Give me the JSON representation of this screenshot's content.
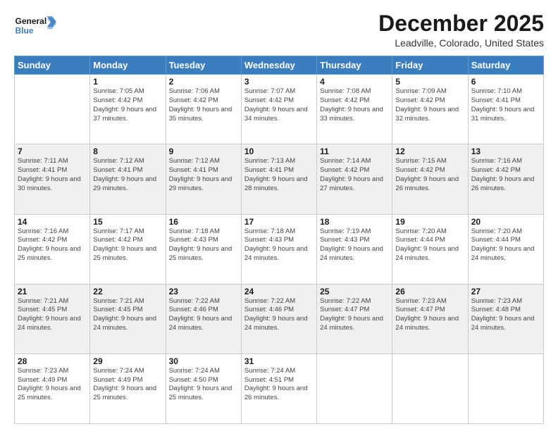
{
  "header": {
    "logo_general": "General",
    "logo_blue": "Blue",
    "month_title": "December 2025",
    "location": "Leadville, Colorado, United States"
  },
  "weekdays": [
    "Sunday",
    "Monday",
    "Tuesday",
    "Wednesday",
    "Thursday",
    "Friday",
    "Saturday"
  ],
  "weeks": [
    [
      {
        "day": "",
        "sunrise": "",
        "sunset": "",
        "daylight": ""
      },
      {
        "day": "1",
        "sunrise": "Sunrise: 7:05 AM",
        "sunset": "Sunset: 4:42 PM",
        "daylight": "Daylight: 9 hours and 37 minutes."
      },
      {
        "day": "2",
        "sunrise": "Sunrise: 7:06 AM",
        "sunset": "Sunset: 4:42 PM",
        "daylight": "Daylight: 9 hours and 35 minutes."
      },
      {
        "day": "3",
        "sunrise": "Sunrise: 7:07 AM",
        "sunset": "Sunset: 4:42 PM",
        "daylight": "Daylight: 9 hours and 34 minutes."
      },
      {
        "day": "4",
        "sunrise": "Sunrise: 7:08 AM",
        "sunset": "Sunset: 4:42 PM",
        "daylight": "Daylight: 9 hours and 33 minutes."
      },
      {
        "day": "5",
        "sunrise": "Sunrise: 7:09 AM",
        "sunset": "Sunset: 4:42 PM",
        "daylight": "Daylight: 9 hours and 32 minutes."
      },
      {
        "day": "6",
        "sunrise": "Sunrise: 7:10 AM",
        "sunset": "Sunset: 4:41 PM",
        "daylight": "Daylight: 9 hours and 31 minutes."
      }
    ],
    [
      {
        "day": "7",
        "sunrise": "Sunrise: 7:11 AM",
        "sunset": "Sunset: 4:41 PM",
        "daylight": "Daylight: 9 hours and 30 minutes."
      },
      {
        "day": "8",
        "sunrise": "Sunrise: 7:12 AM",
        "sunset": "Sunset: 4:41 PM",
        "daylight": "Daylight: 9 hours and 29 minutes."
      },
      {
        "day": "9",
        "sunrise": "Sunrise: 7:12 AM",
        "sunset": "Sunset: 4:41 PM",
        "daylight": "Daylight: 9 hours and 29 minutes."
      },
      {
        "day": "10",
        "sunrise": "Sunrise: 7:13 AM",
        "sunset": "Sunset: 4:41 PM",
        "daylight": "Daylight: 9 hours and 28 minutes."
      },
      {
        "day": "11",
        "sunrise": "Sunrise: 7:14 AM",
        "sunset": "Sunset: 4:42 PM",
        "daylight": "Daylight: 9 hours and 27 minutes."
      },
      {
        "day": "12",
        "sunrise": "Sunrise: 7:15 AM",
        "sunset": "Sunset: 4:42 PM",
        "daylight": "Daylight: 9 hours and 26 minutes."
      },
      {
        "day": "13",
        "sunrise": "Sunrise: 7:16 AM",
        "sunset": "Sunset: 4:42 PM",
        "daylight": "Daylight: 9 hours and 26 minutes."
      }
    ],
    [
      {
        "day": "14",
        "sunrise": "Sunrise: 7:16 AM",
        "sunset": "Sunset: 4:42 PM",
        "daylight": "Daylight: 9 hours and 25 minutes."
      },
      {
        "day": "15",
        "sunrise": "Sunrise: 7:17 AM",
        "sunset": "Sunset: 4:42 PM",
        "daylight": "Daylight: 9 hours and 25 minutes."
      },
      {
        "day": "16",
        "sunrise": "Sunrise: 7:18 AM",
        "sunset": "Sunset: 4:43 PM",
        "daylight": "Daylight: 9 hours and 25 minutes."
      },
      {
        "day": "17",
        "sunrise": "Sunrise: 7:18 AM",
        "sunset": "Sunset: 4:43 PM",
        "daylight": "Daylight: 9 hours and 24 minutes."
      },
      {
        "day": "18",
        "sunrise": "Sunrise: 7:19 AM",
        "sunset": "Sunset: 4:43 PM",
        "daylight": "Daylight: 9 hours and 24 minutes."
      },
      {
        "day": "19",
        "sunrise": "Sunrise: 7:20 AM",
        "sunset": "Sunset: 4:44 PM",
        "daylight": "Daylight: 9 hours and 24 minutes."
      },
      {
        "day": "20",
        "sunrise": "Sunrise: 7:20 AM",
        "sunset": "Sunset: 4:44 PM",
        "daylight": "Daylight: 9 hours and 24 minutes."
      }
    ],
    [
      {
        "day": "21",
        "sunrise": "Sunrise: 7:21 AM",
        "sunset": "Sunset: 4:45 PM",
        "daylight": "Daylight: 9 hours and 24 minutes."
      },
      {
        "day": "22",
        "sunrise": "Sunrise: 7:21 AM",
        "sunset": "Sunset: 4:45 PM",
        "daylight": "Daylight: 9 hours and 24 minutes."
      },
      {
        "day": "23",
        "sunrise": "Sunrise: 7:22 AM",
        "sunset": "Sunset: 4:46 PM",
        "daylight": "Daylight: 9 hours and 24 minutes."
      },
      {
        "day": "24",
        "sunrise": "Sunrise: 7:22 AM",
        "sunset": "Sunset: 4:46 PM",
        "daylight": "Daylight: 9 hours and 24 minutes."
      },
      {
        "day": "25",
        "sunrise": "Sunrise: 7:22 AM",
        "sunset": "Sunset: 4:47 PM",
        "daylight": "Daylight: 9 hours and 24 minutes."
      },
      {
        "day": "26",
        "sunrise": "Sunrise: 7:23 AM",
        "sunset": "Sunset: 4:47 PM",
        "daylight": "Daylight: 9 hours and 24 minutes."
      },
      {
        "day": "27",
        "sunrise": "Sunrise: 7:23 AM",
        "sunset": "Sunset: 4:48 PM",
        "daylight": "Daylight: 9 hours and 24 minutes."
      }
    ],
    [
      {
        "day": "28",
        "sunrise": "Sunrise: 7:23 AM",
        "sunset": "Sunset: 4:49 PM",
        "daylight": "Daylight: 9 hours and 25 minutes."
      },
      {
        "day": "29",
        "sunrise": "Sunrise: 7:24 AM",
        "sunset": "Sunset: 4:49 PM",
        "daylight": "Daylight: 9 hours and 25 minutes."
      },
      {
        "day": "30",
        "sunrise": "Sunrise: 7:24 AM",
        "sunset": "Sunset: 4:50 PM",
        "daylight": "Daylight: 9 hours and 25 minutes."
      },
      {
        "day": "31",
        "sunrise": "Sunrise: 7:24 AM",
        "sunset": "Sunset: 4:51 PM",
        "daylight": "Daylight: 9 hours and 26 minutes."
      },
      {
        "day": "",
        "sunrise": "",
        "sunset": "",
        "daylight": ""
      },
      {
        "day": "",
        "sunrise": "",
        "sunset": "",
        "daylight": ""
      },
      {
        "day": "",
        "sunrise": "",
        "sunset": "",
        "daylight": ""
      }
    ]
  ]
}
